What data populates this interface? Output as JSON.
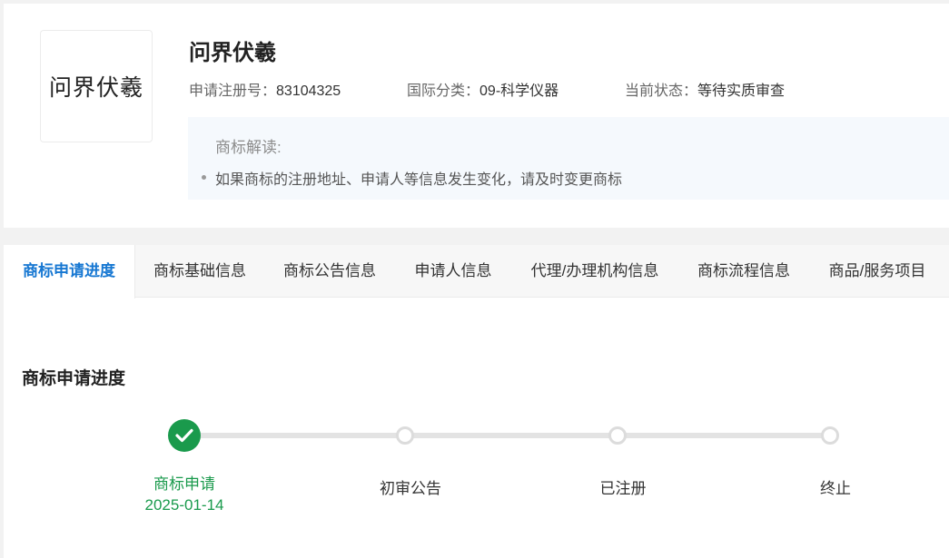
{
  "trademark": {
    "logo_text": "问界伏羲",
    "name": "问界伏羲"
  },
  "meta": {
    "reg_no_label": "申请注册号：",
    "reg_no": "83104325",
    "class_label": "国际分类：",
    "class_value": "09-科学仪器",
    "status_label": "当前状态：",
    "status_value": "等待实质审查"
  },
  "interpretation": {
    "title": "商标解读:",
    "items": [
      "如果商标的注册地址、申请人等信息发生变化，请及时变更商标"
    ]
  },
  "tabs": [
    {
      "label": "商标申请进度",
      "active": true
    },
    {
      "label": "商标基础信息",
      "active": false
    },
    {
      "label": "商标公告信息",
      "active": false
    },
    {
      "label": "申请人信息",
      "active": false
    },
    {
      "label": "代理/办理机构信息",
      "active": false
    },
    {
      "label": "商标流程信息",
      "active": false
    },
    {
      "label": "商品/服务项目",
      "active": false
    }
  ],
  "progress": {
    "title": "商标申请进度",
    "steps": [
      {
        "label": "商标申请",
        "date": "2025-01-14",
        "done": true
      },
      {
        "label": "初审公告",
        "date": "",
        "done": false
      },
      {
        "label": "已注册",
        "date": "",
        "done": false
      },
      {
        "label": "终止",
        "date": "",
        "done": false
      }
    ]
  },
  "colors": {
    "accent": "#1677d2",
    "done": "#1a9a4c",
    "pending": "#dcdcdc"
  }
}
